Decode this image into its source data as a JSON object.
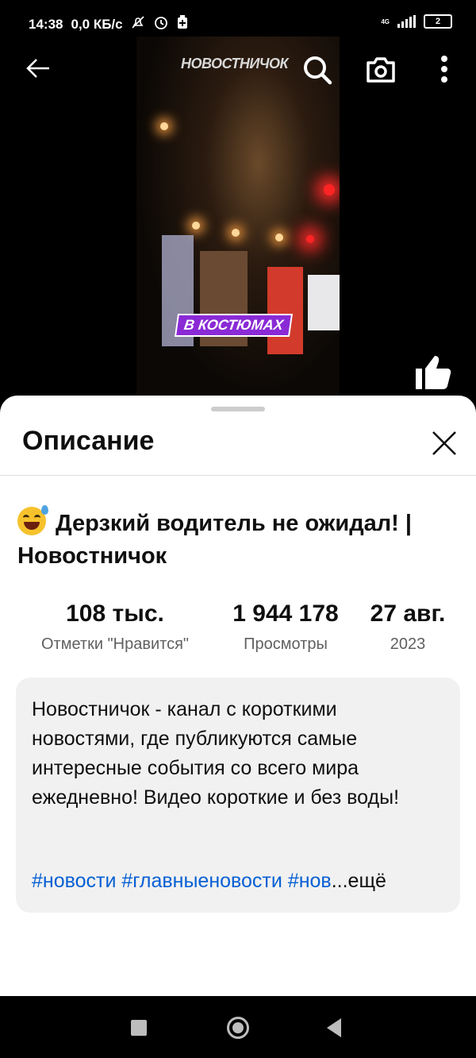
{
  "status_bar": {
    "time": "14:38",
    "speed": "0,0 КБ/с",
    "network": "4G",
    "battery": "2"
  },
  "player": {
    "channel_watermark": "НОВОСТНИЧОК",
    "video_caption": "В КОСТЮМАХ"
  },
  "sheet": {
    "title": "Описание",
    "video_title": "Дерзкий водитель не ожидал! | Новостничок",
    "stats": [
      {
        "value": "108 тыс.",
        "label": "Отметки \"Нравится\""
      },
      {
        "value": "1 944 178",
        "label": "Просмотры"
      },
      {
        "value": "27 авг.",
        "label": "2023"
      }
    ],
    "description": "Новостничок - канал с короткими новостями, где публикуются самые интересные события со всего мира ежедневно! Видео короткие и без воды!",
    "hashtags": [
      "#новости",
      "#главныеновости",
      "#нов"
    ],
    "more": "...ещё"
  },
  "icons": {
    "back": "arrow-left-icon",
    "search": "search-icon",
    "camera": "camera-icon",
    "menu": "more-vertical-icon",
    "like": "thumbs-up-icon",
    "close": "close-icon"
  },
  "colors": {
    "link": "#065fd4",
    "caption_bg": "#8a2ad6"
  }
}
